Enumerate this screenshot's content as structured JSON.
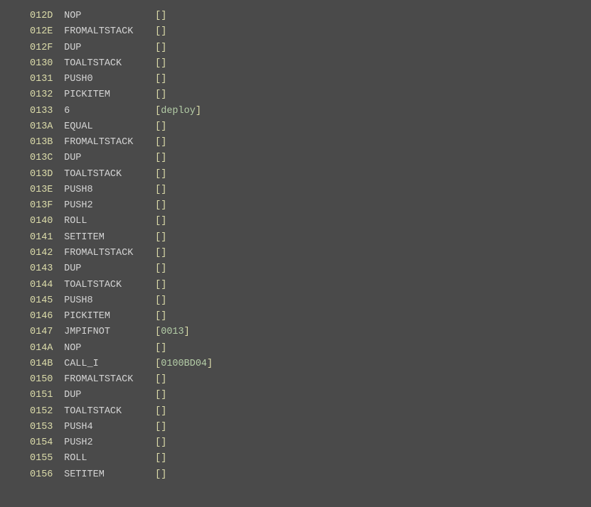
{
  "lines": [
    {
      "addr": "012D",
      "opcode": "NOP",
      "operand": ""
    },
    {
      "addr": "012E",
      "opcode": "FROMALTSTACK",
      "operand": ""
    },
    {
      "addr": "012F",
      "opcode": "DUP",
      "operand": ""
    },
    {
      "addr": "0130",
      "opcode": "TOALTSTACK",
      "operand": ""
    },
    {
      "addr": "0131",
      "opcode": "PUSH0",
      "operand": ""
    },
    {
      "addr": "0132",
      "opcode": "PICKITEM",
      "operand": ""
    },
    {
      "addr": "0133",
      "opcode": "6",
      "operand": "deploy"
    },
    {
      "addr": "013A",
      "opcode": "EQUAL",
      "operand": ""
    },
    {
      "addr": "013B",
      "opcode": "FROMALTSTACK",
      "operand": ""
    },
    {
      "addr": "013C",
      "opcode": "DUP",
      "operand": ""
    },
    {
      "addr": "013D",
      "opcode": "TOALTSTACK",
      "operand": ""
    },
    {
      "addr": "013E",
      "opcode": "PUSH8",
      "operand": ""
    },
    {
      "addr": "013F",
      "opcode": "PUSH2",
      "operand": ""
    },
    {
      "addr": "0140",
      "opcode": "ROLL",
      "operand": ""
    },
    {
      "addr": "0141",
      "opcode": "SETITEM",
      "operand": ""
    },
    {
      "addr": "0142",
      "opcode": "FROMALTSTACK",
      "operand": ""
    },
    {
      "addr": "0143",
      "opcode": "DUP",
      "operand": ""
    },
    {
      "addr": "0144",
      "opcode": "TOALTSTACK",
      "operand": ""
    },
    {
      "addr": "0145",
      "opcode": "PUSH8",
      "operand": ""
    },
    {
      "addr": "0146",
      "opcode": "PICKITEM",
      "operand": ""
    },
    {
      "addr": "0147",
      "opcode": "JMPIFNOT",
      "operand": "0013"
    },
    {
      "addr": "014A",
      "opcode": "NOP",
      "operand": ""
    },
    {
      "addr": "014B",
      "opcode": "CALL_I",
      "operand": "0100BD04"
    },
    {
      "addr": "0150",
      "opcode": "FROMALTSTACK",
      "operand": ""
    },
    {
      "addr": "0151",
      "opcode": "DUP",
      "operand": ""
    },
    {
      "addr": "0152",
      "opcode": "TOALTSTACK",
      "operand": ""
    },
    {
      "addr": "0153",
      "opcode": "PUSH4",
      "operand": ""
    },
    {
      "addr": "0154",
      "opcode": "PUSH2",
      "operand": ""
    },
    {
      "addr": "0155",
      "opcode": "ROLL",
      "operand": ""
    },
    {
      "addr": "0156",
      "opcode": "SETITEM",
      "operand": ""
    }
  ]
}
